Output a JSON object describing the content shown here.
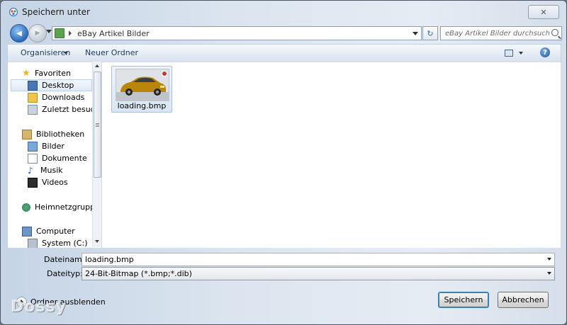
{
  "window": {
    "title": "Speichern unter",
    "close_glyph": "✕",
    "title_icon": "save-dialog-icon"
  },
  "navbar": {
    "back_glyph": "◀",
    "forward_glyph": "▶",
    "refresh_glyph": "↻",
    "address_crumb": "eBay Artikel Bilder",
    "search_placeholder": "eBay Artikel Bilder durchsuchen"
  },
  "toolbar": {
    "organize_label": "Organisieren",
    "new_folder_label": "Neuer Ordner",
    "help_glyph": "?"
  },
  "sidebar": {
    "favorites": {
      "label": "Favoriten",
      "icon": "star-icon"
    },
    "favorites_items": [
      {
        "label": "Desktop",
        "icon": "desktop-icon",
        "selected": true
      },
      {
        "label": "Downloads",
        "icon": "downloads-icon"
      },
      {
        "label": "Zuletzt besucht",
        "icon": "recent-places-icon"
      }
    ],
    "libraries": {
      "label": "Bibliotheken",
      "icon": "libraries-icon"
    },
    "libraries_items": [
      {
        "label": "Bilder",
        "icon": "pictures-icon"
      },
      {
        "label": "Dokumente",
        "icon": "documents-icon"
      },
      {
        "label": "Musik",
        "icon": "music-icon"
      },
      {
        "label": "Videos",
        "icon": "videos-icon"
      }
    ],
    "homegroup": {
      "label": "Heimnetzgruppe",
      "icon": "homegroup-icon"
    },
    "computer": {
      "label": "Computer",
      "icon": "computer-icon"
    },
    "computer_items": [
      {
        "label": "System (C:)",
        "icon": "drive-icon"
      }
    ]
  },
  "files": [
    {
      "name": "loading.bmp",
      "thumbnail": "car-thumbnail"
    }
  ],
  "form": {
    "filename_label": "Dateiname:",
    "filename_value": "loading.bmp",
    "filetype_label": "Dateityp:",
    "filetype_value": "24-Bit-Bitmap (*.bmp;*.dib)"
  },
  "footer": {
    "hide_folders_label": "Ordner ausblenden",
    "save_label": "Speichern",
    "cancel_label": "Abbrechen",
    "watermark": "Dossy"
  },
  "colors": {
    "accent": "#3c7fb1",
    "link_text": "#1e395b",
    "selection_bg": "#dfe9f6"
  }
}
